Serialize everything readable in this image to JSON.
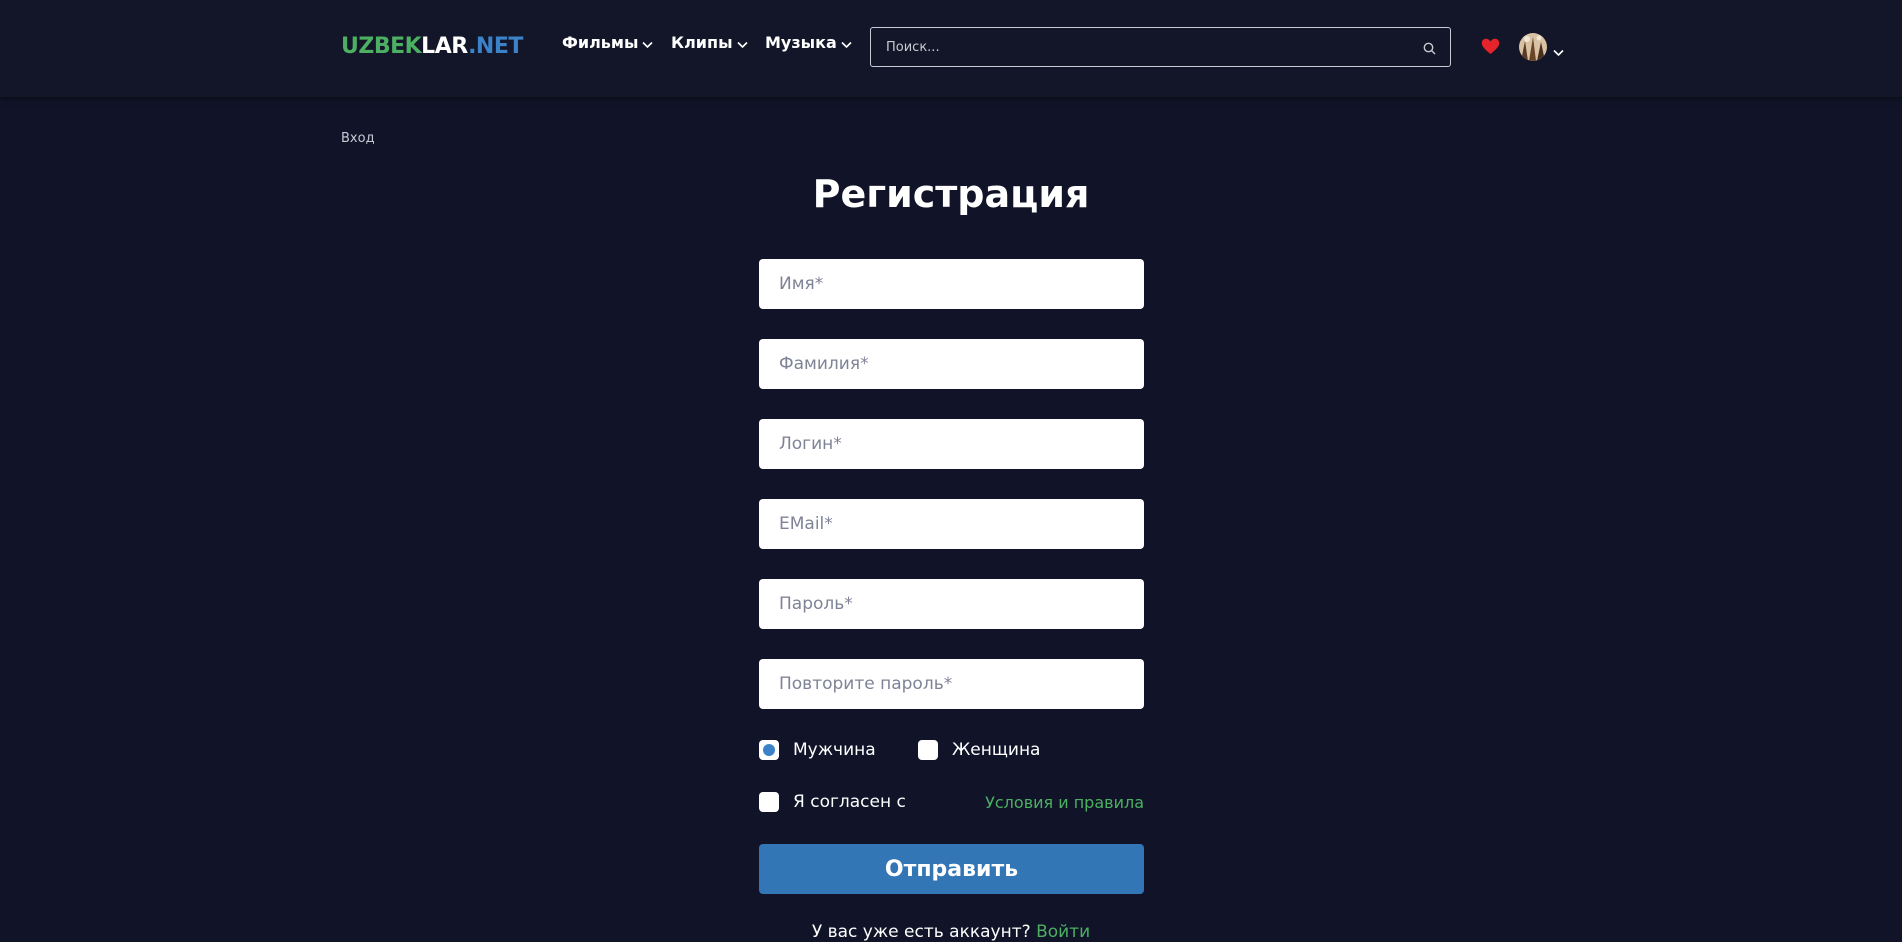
{
  "header": {
    "logo": {
      "part1": "UZBEK",
      "part2": "LAR",
      "part3": ".NET"
    },
    "nav": [
      {
        "label": "Фильмы"
      },
      {
        "label": "Клипы"
      },
      {
        "label": "Музыка"
      }
    ],
    "search": {
      "placeholder": "Поиск..."
    }
  },
  "breadcrumb": "Вход",
  "form": {
    "title": "Регистрация",
    "fields": {
      "first_name": "Имя*",
      "last_name": "Фамилия*",
      "login": "Логин*",
      "email": "EMail*",
      "password": "Пароль*",
      "password_repeat": "Повторите пароль*"
    },
    "gender": {
      "male": "Мужчина",
      "female": "Женщина",
      "selected": "male"
    },
    "agree_label": "Я согласен с",
    "terms_link": "Условия и правила",
    "submit": "Отправить",
    "bottom_text": "У вас уже есть аккаунт?",
    "bottom_link": "Войти"
  },
  "colors": {
    "background": "#111428",
    "logo_green": "#4caf62",
    "logo_blue": "#3b82c9",
    "button_blue": "#3276b6",
    "link_green": "#4caf62",
    "heart_red": "#e5232b"
  },
  "icons": [
    "chevron-down-icon",
    "search-icon",
    "heart-icon",
    "avatar"
  ]
}
